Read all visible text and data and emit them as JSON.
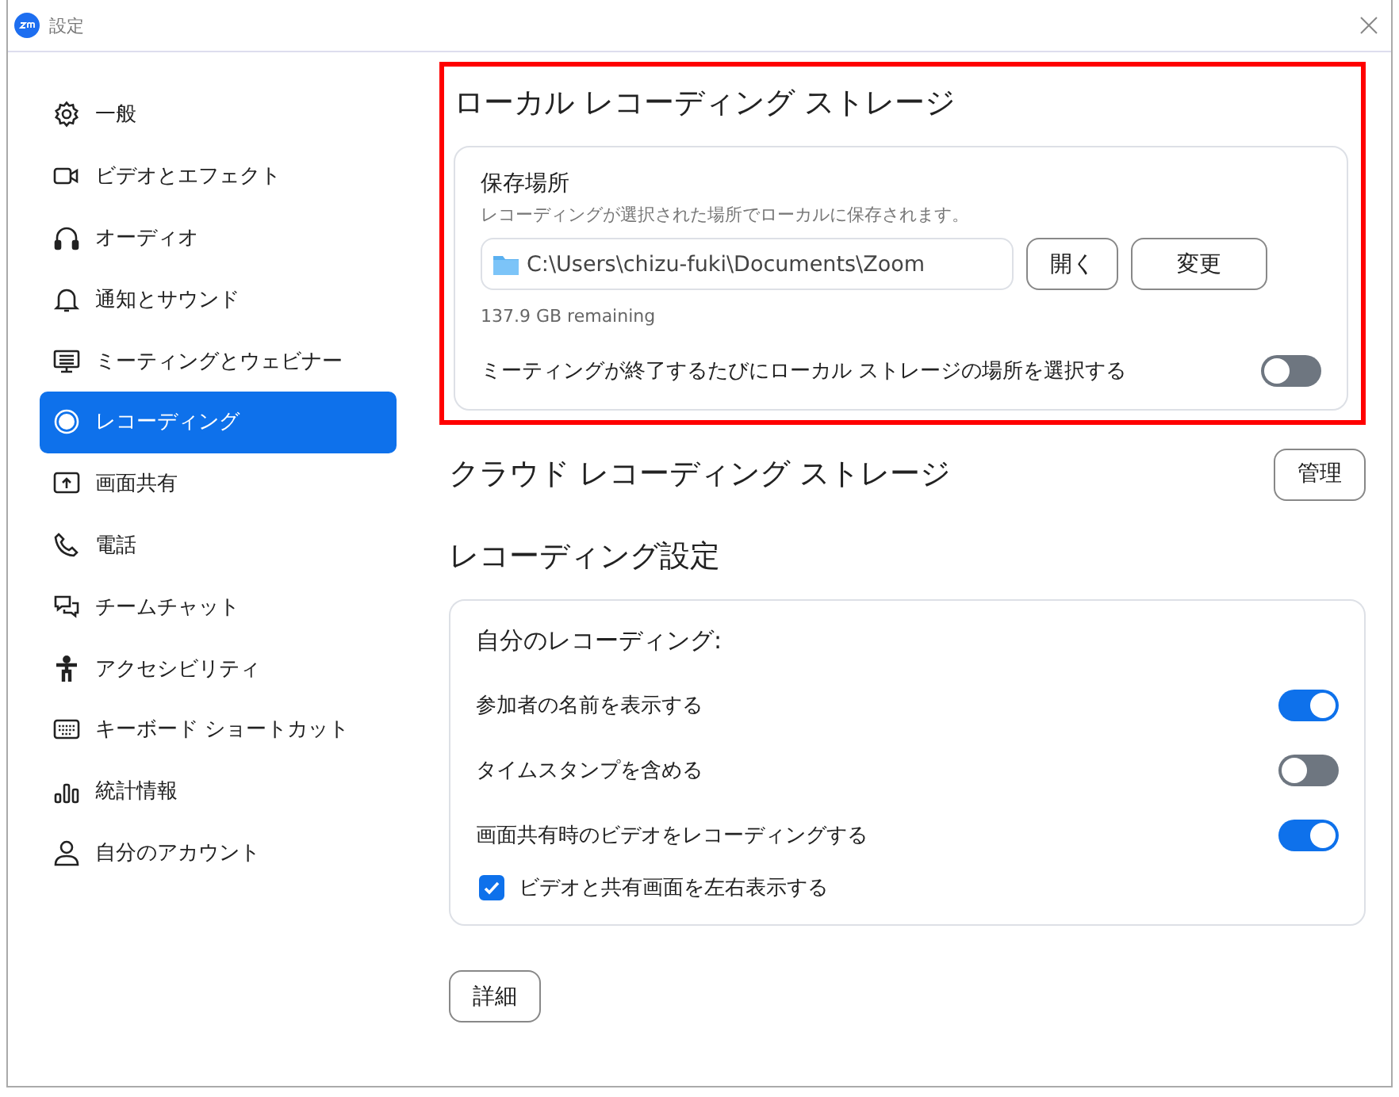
{
  "window": {
    "title": "設定"
  },
  "sidebar": {
    "items": [
      {
        "label": "一般",
        "selected": false
      },
      {
        "label": "ビデオとエフェクト",
        "selected": false
      },
      {
        "label": "オーディオ",
        "selected": false
      },
      {
        "label": "通知とサウンド",
        "selected": false
      },
      {
        "label": "ミーティングとウェビナー",
        "selected": false
      },
      {
        "label": "レコーディング",
        "selected": true
      },
      {
        "label": "画面共有",
        "selected": false
      },
      {
        "label": "電話",
        "selected": false
      },
      {
        "label": "チームチャット",
        "selected": false
      },
      {
        "label": "アクセシビリティ",
        "selected": false
      },
      {
        "label": "キーボード ショートカット",
        "selected": false
      },
      {
        "label": "統計情報",
        "selected": false
      },
      {
        "label": "自分のアカウント",
        "selected": false
      }
    ]
  },
  "local_storage": {
    "title": "ローカル レコーディング ストレージ",
    "highlighted": true,
    "location_label": "保存場所",
    "description": "レコーディングが選択された場所でローカルに保存されます。",
    "path": "C:\\Users\\chizu-fuki\\Documents\\Zoom",
    "buttons": [
      "開く",
      "変更"
    ],
    "remaining": "137.9 GB remaining",
    "choose_toggle": {
      "label": "ミーティングが終了するたびにローカル ストレージの場所を選択する",
      "on": false
    }
  },
  "cloud_storage": {
    "title": "クラウド レコーディング ストレージ",
    "button": "管理"
  },
  "recording_settings": {
    "title": "レコーディング設定",
    "group_title": "自分のレコーディング:",
    "options": [
      {
        "kind": "toggle",
        "label": "参加者の名前を表示する",
        "on": true
      },
      {
        "kind": "toggle",
        "label": "タイムスタンプを含める",
        "on": false
      },
      {
        "kind": "toggle",
        "label": "画面共有時のビデオをレコーディングする",
        "on": true
      },
      {
        "kind": "checkbox",
        "label": "ビデオと共有画面を左右表示する",
        "checked": true
      }
    ]
  },
  "details_button": "詳細"
}
